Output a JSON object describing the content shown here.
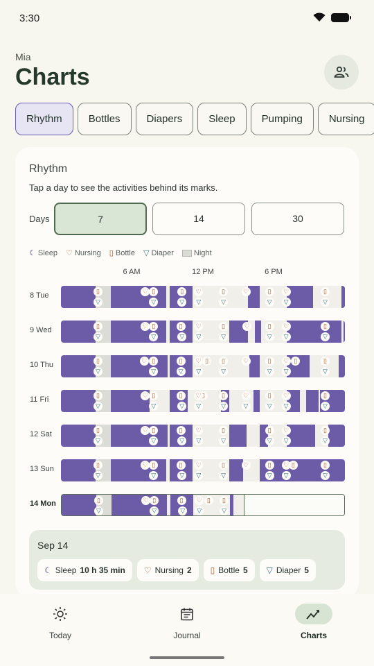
{
  "status_bar": {
    "time": "3:30"
  },
  "header": {
    "child_name": "Mia",
    "title": "Charts"
  },
  "tabs": [
    {
      "label": "Rhythm",
      "active": true
    },
    {
      "label": "Bottles"
    },
    {
      "label": "Diapers"
    },
    {
      "label": "Sleep"
    },
    {
      "label": "Pumping"
    },
    {
      "label": "Nursing"
    }
  ],
  "card": {
    "title": "Rhythm",
    "subtitle": "Tap a day to see the activities behind its marks.",
    "days_label": "Days",
    "day_options": [
      "7",
      "14",
      "30"
    ],
    "selected_days": "7",
    "legend": {
      "sleep": "Sleep",
      "nursing": "Nursing",
      "bottle": "Bottle",
      "diaper": "Diaper",
      "night": "Night"
    },
    "hour_labels": [
      "6 AM",
      "12 PM",
      "6 PM"
    ]
  },
  "rhythm_rows": [
    {
      "label": "8 Tue",
      "sleep": [
        [
          0,
          2.9
        ],
        [
          4.2,
          8.9
        ],
        [
          9.2,
          11.1
        ],
        [
          15.8,
          16.8
        ],
        [
          19.1,
          21.3
        ],
        [
          23.7,
          24
        ]
      ],
      "nursing": [
        7.1,
        11.6,
        15.6,
        19.0
      ],
      "bottle": [
        3.1,
        7.8,
        10.2,
        13.7,
        17.6,
        22.3
      ],
      "diaper": [
        3.1,
        7.8,
        10.2,
        11.6,
        13.7,
        17.6,
        19.0,
        22.3
      ]
    },
    {
      "label": "9 Wed",
      "sleep": [
        [
          0,
          2.9
        ],
        [
          4.2,
          8.9
        ],
        [
          9.2,
          11.1
        ],
        [
          14.2,
          15.8
        ],
        [
          16.4,
          16.9
        ],
        [
          19.1,
          23.7
        ],
        [
          23.9,
          24
        ]
      ],
      "nursing": [
        7.1,
        11.6,
        15.7,
        19.0
      ],
      "bottle": [
        3.1,
        7.8,
        10.1,
        13.7,
        17.6,
        22.3
      ],
      "diaper": [
        3.1,
        7.8,
        10.2,
        11.6,
        13.7,
        17.6,
        19.0,
        22.3
      ]
    },
    {
      "label": "10 Thu",
      "sleep": [
        [
          0,
          2.9
        ],
        [
          4.2,
          9.0
        ],
        [
          9.2,
          11.1
        ],
        [
          15.9,
          16.8
        ],
        [
          19.1,
          21.0
        ],
        [
          23.5,
          24
        ]
      ],
      "nursing": [
        7.0,
        11.6,
        15.6,
        19.0
      ],
      "bottle": [
        3.1,
        7.8,
        10.1,
        12.3,
        13.7,
        17.6,
        19.8,
        22.3
      ],
      "diaper": [
        3.1,
        7.8,
        10.1,
        11.6,
        13.7,
        17.6,
        19.0,
        22.3
      ]
    },
    {
      "label": "11 Fri",
      "sleep": [
        [
          0,
          2.9
        ],
        [
          4.2,
          7.5
        ],
        [
          9.2,
          10.7
        ],
        [
          13.5,
          14.2
        ],
        [
          16.3,
          16.8
        ],
        [
          19.1,
          20.2
        ],
        [
          20.7,
          21.8
        ],
        [
          21.9,
          24
        ]
      ],
      "nursing": [
        7.1,
        11.6,
        15.6,
        19.0
      ],
      "bottle": [
        3.1,
        7.8,
        10.1,
        12.0,
        13.7,
        17.6,
        22.3
      ],
      "diaper": [
        3.1,
        7.8,
        10.2,
        11.6,
        13.7,
        15.6,
        17.6,
        19.0,
        22.3
      ]
    },
    {
      "label": "12 Sat",
      "sleep": [
        [
          0,
          2.9
        ],
        [
          4.2,
          9.0
        ],
        [
          9.2,
          11.1
        ],
        [
          14.2,
          15.7
        ],
        [
          16.8,
          17.5
        ],
        [
          19.1,
          21.5
        ],
        [
          22.6,
          24
        ]
      ],
      "nursing": [
        7.1,
        11.6,
        19.0
      ],
      "bottle": [
        3.1,
        7.8,
        10.1,
        13.7,
        17.6,
        22.3
      ],
      "diaper": [
        3.1,
        7.8,
        10.2,
        11.6,
        13.7,
        17.6,
        19.0,
        22.3
      ]
    },
    {
      "label": "13 Sun",
      "sleep": [
        [
          0,
          2.9
        ],
        [
          4.2,
          8.9
        ],
        [
          9.2,
          11.1
        ],
        [
          14.2,
          15.4
        ],
        [
          16.8,
          24
        ]
      ],
      "nursing": [
        7.1,
        11.6,
        15.6,
        19.0
      ],
      "bottle": [
        3.1,
        7.8,
        10.1,
        13.7,
        17.6,
        19.6,
        22.3
      ],
      "diaper": [
        3.1,
        7.8,
        10.2,
        11.6,
        13.7,
        17.6,
        19.0,
        22.3
      ]
    },
    {
      "label": "14 Mon",
      "today": true,
      "now": 15.4,
      "sleep": [
        [
          0,
          2.9
        ],
        [
          4.2,
          8.9
        ],
        [
          9.2,
          11.1
        ],
        [
          14.2,
          14.5
        ]
      ],
      "nursing": [
        7.1,
        11.6
      ],
      "bottle": [
        3.1,
        7.8,
        10.1,
        12.4,
        13.7
      ],
      "diaper": [
        3.1,
        7.8,
        10.2,
        11.6,
        13.7
      ]
    }
  ],
  "summary": {
    "date": "Sep 14",
    "chips": [
      {
        "label": "Sleep",
        "value": "10 h 35 min"
      },
      {
        "label": "Nursing",
        "value": "2"
      },
      {
        "label": "Bottle",
        "value": "5"
      },
      {
        "label": "Diaper",
        "value": "5"
      }
    ]
  },
  "nav": [
    {
      "label": "Today"
    },
    {
      "label": "Journal"
    },
    {
      "label": "Charts",
      "active": true
    }
  ]
}
